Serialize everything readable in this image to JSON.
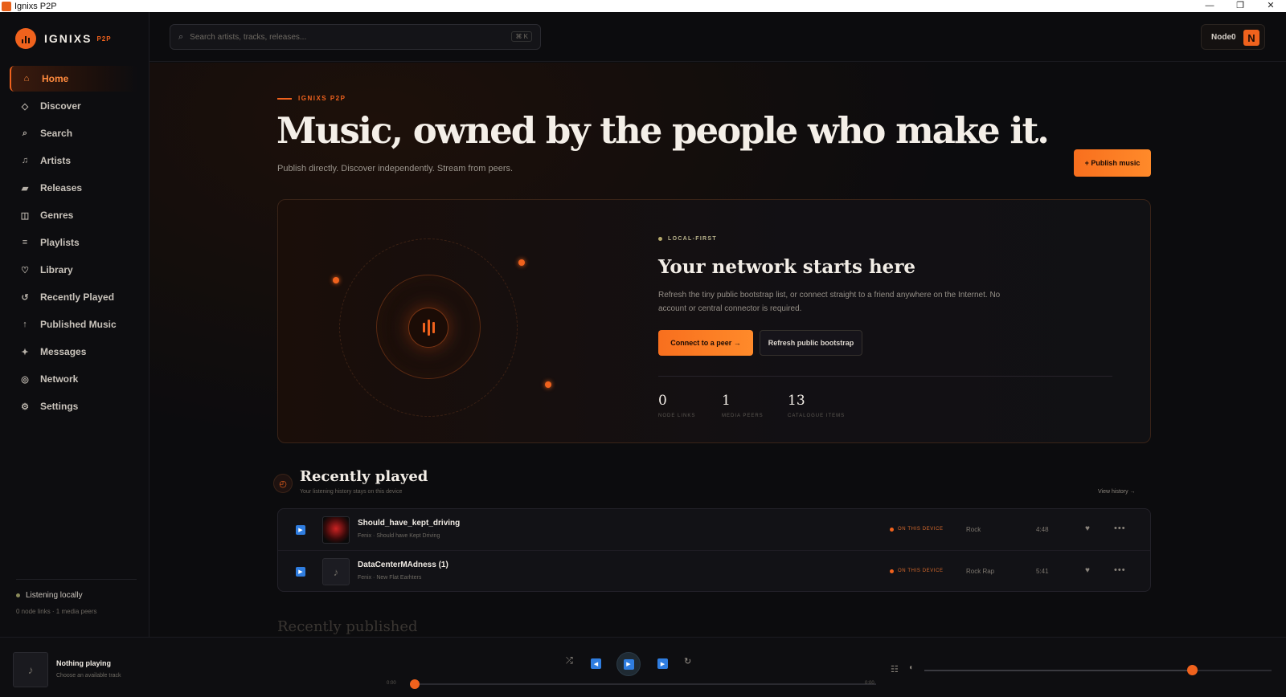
{
  "window": {
    "title": "Ignixs P2P",
    "buttons": [
      "—",
      "❐",
      "✕"
    ]
  },
  "brand": {
    "name": "IGNIXS",
    "sub": "P2P",
    "accent": "#f0621d"
  },
  "sidebar": {
    "items": [
      {
        "label": "Home",
        "icon": "home-icon",
        "glyph": "⌂",
        "active": true
      },
      {
        "label": "Discover",
        "icon": "compass-icon",
        "glyph": "◇"
      },
      {
        "label": "Search",
        "icon": "search-icon",
        "glyph": "⌕"
      },
      {
        "label": "Artists",
        "icon": "music-note-icon",
        "glyph": "♫"
      },
      {
        "label": "Releases",
        "icon": "disc-icon",
        "glyph": "▰"
      },
      {
        "label": "Genres",
        "icon": "grid-icon",
        "glyph": "◫"
      },
      {
        "label": "Playlists",
        "icon": "list-icon",
        "glyph": "≡"
      },
      {
        "label": "Library",
        "icon": "heart-icon",
        "glyph": "♡"
      },
      {
        "label": "Recently Played",
        "icon": "history-icon",
        "glyph": "↺"
      },
      {
        "label": "Published Music",
        "icon": "upload-icon",
        "glyph": "↑"
      },
      {
        "label": "Messages",
        "icon": "sparkle-icon",
        "glyph": "✦"
      },
      {
        "label": "Network",
        "icon": "network-icon",
        "glyph": "◎"
      },
      {
        "label": "Settings",
        "icon": "gear-icon",
        "glyph": "⚙"
      }
    ],
    "status": {
      "label": "Listening locally",
      "detail": "0 node links · 1 media peers"
    }
  },
  "topbar": {
    "search_placeholder": "Search artists, tracks, releases...",
    "shortcut": "⌘ K",
    "node_name": "Node0",
    "node_initial": "N"
  },
  "hero": {
    "eyebrow": "IGNIXS P2P",
    "title": "Music, owned by the people who make it.",
    "subtitle": "Publish directly. Discover independently. Stream from peers.",
    "publish_label": "+ Publish music"
  },
  "network_card": {
    "eyebrow": "LOCAL-FIRST",
    "title": "Your network starts here",
    "description": "Refresh the tiny public bootstrap list, or connect straight to a friend anywhere on the Internet. No account or central connector is required.",
    "connect_label": "Connect to a peer  →",
    "refresh_label": "Refresh public bootstrap",
    "stats": [
      {
        "value": "0",
        "label": "NODE LINKS"
      },
      {
        "value": "1",
        "label": "MEDIA PEERS"
      },
      {
        "value": "13",
        "label": "CATALOGUE ITEMS"
      }
    ]
  },
  "recently_played": {
    "title": "Recently played",
    "subtitle": "Your listening history stays on this device",
    "view_history": "View history →",
    "tracks": [
      {
        "title": "Should_have_kept_driving",
        "meta": "Fenix · Should have Kept Driving",
        "location": "ON THIS DEVICE",
        "genre": "Rock",
        "duration": "4:48"
      },
      {
        "title": "DataCenterMAdness (1)",
        "meta": "Fenix · New Flat Earhters",
        "location": "ON THIS DEVICE",
        "genre": "Rock Rap",
        "duration": "5:41"
      }
    ]
  },
  "next_section_title": "Recently published",
  "player": {
    "title": "Nothing playing",
    "subtitle": "Choose an available track",
    "time_current": "0:00",
    "time_total": "0:00",
    "progress": 0,
    "volume": 0.77
  }
}
